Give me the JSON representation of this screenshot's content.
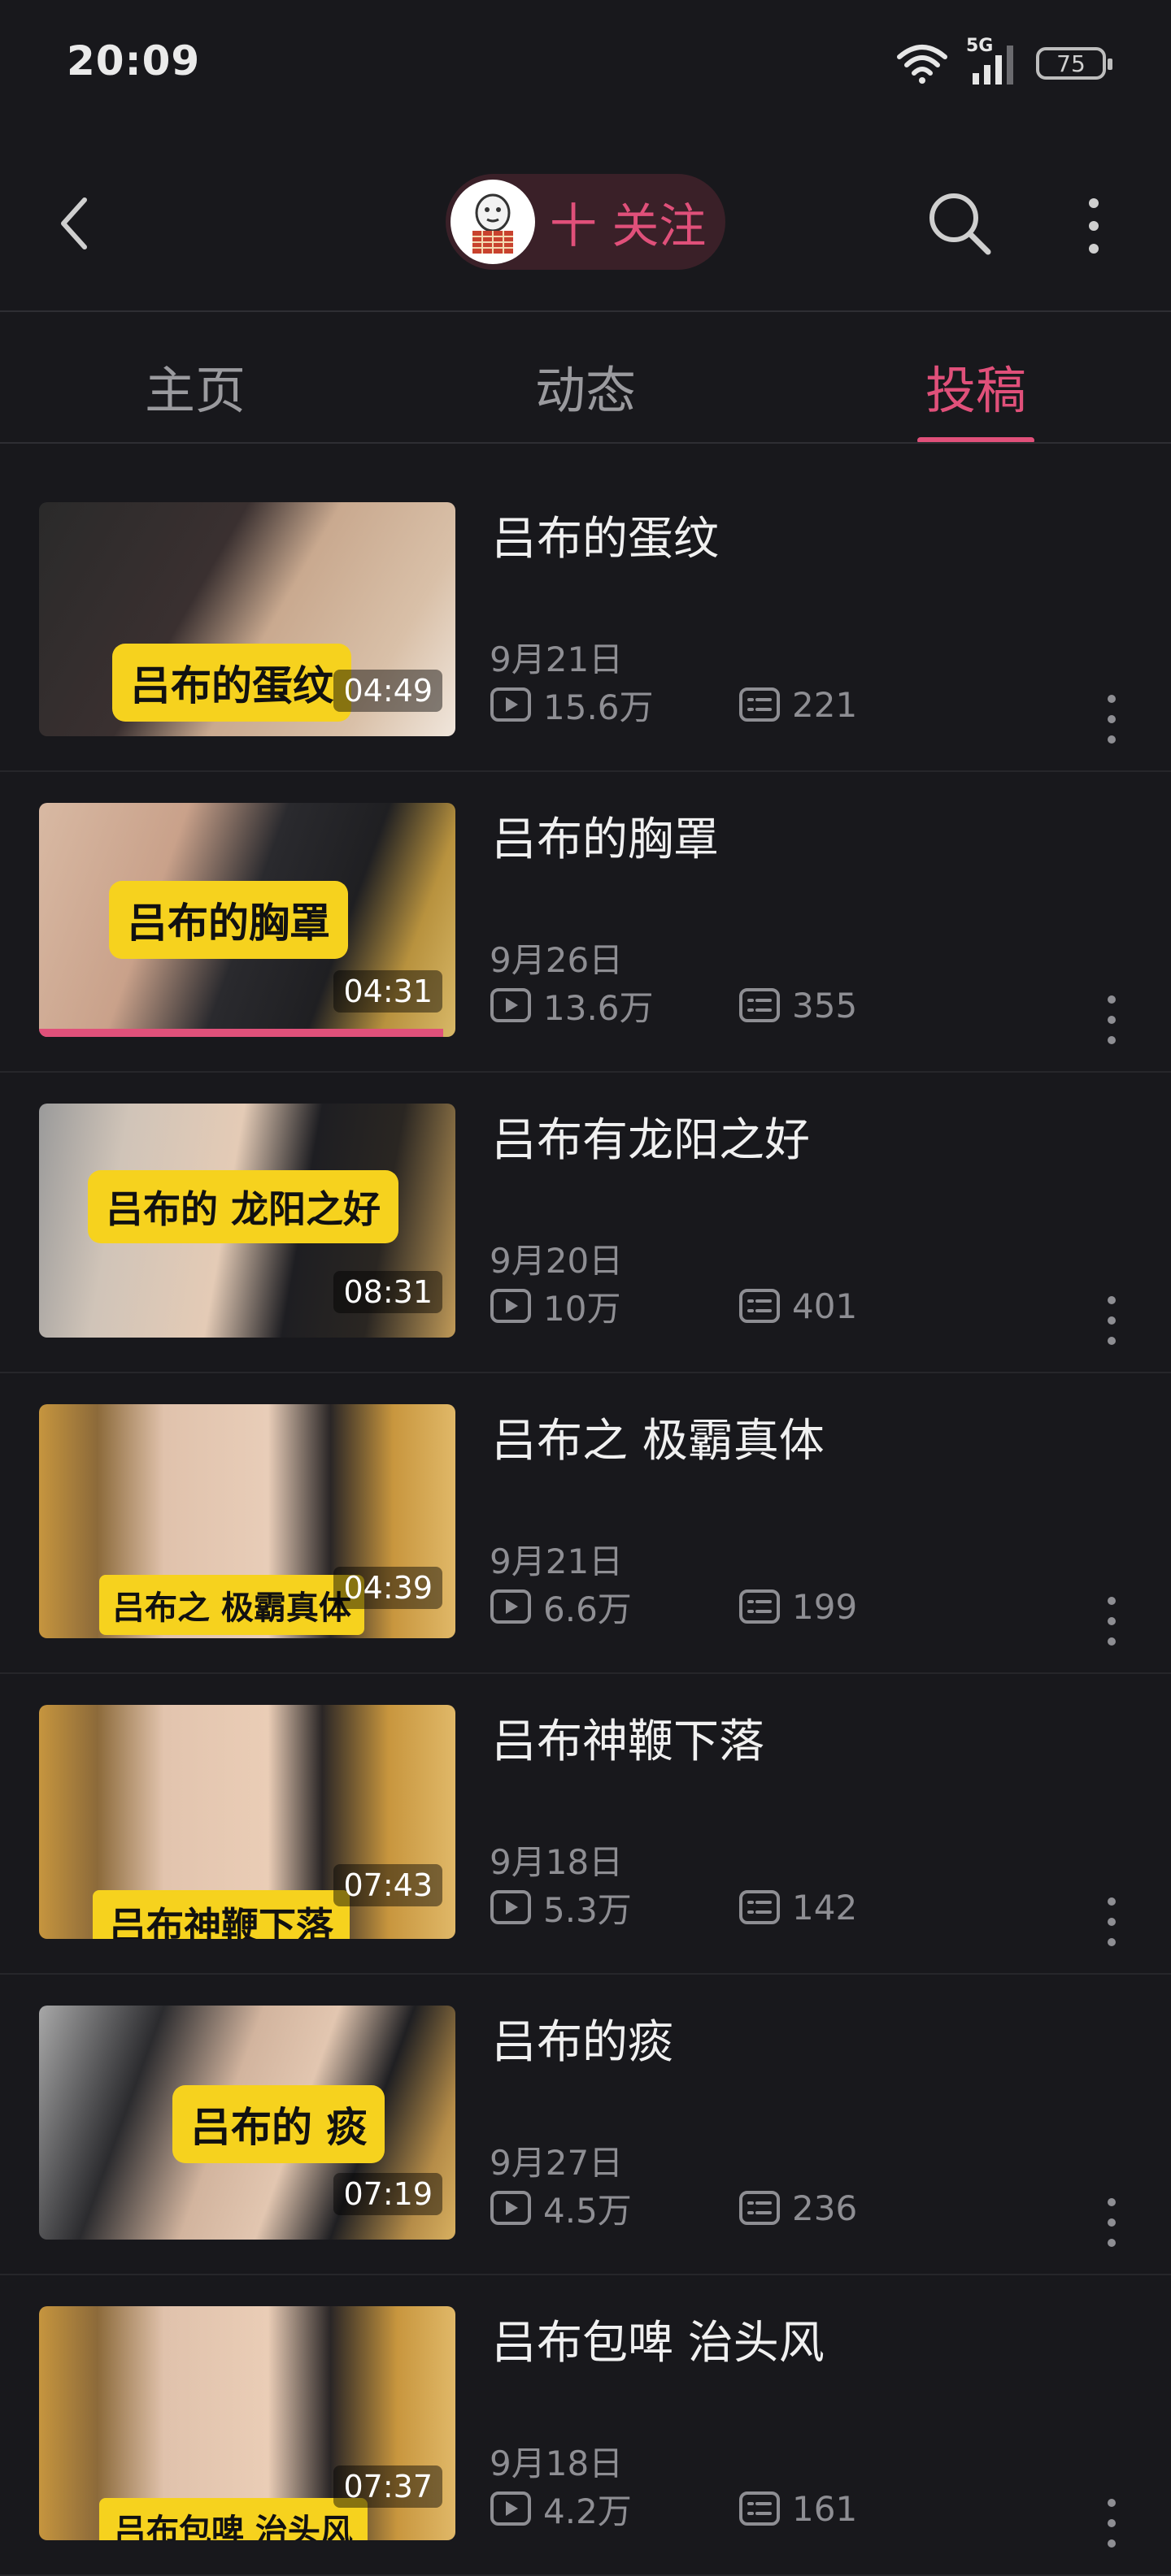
{
  "status_bar": {
    "time": "20:09",
    "network": "5G",
    "battery": "75"
  },
  "header": {
    "follow_label": "十 关注",
    "accent_color": "#e0507a"
  },
  "tabs": [
    {
      "label": "主页",
      "active": false
    },
    {
      "label": "动态",
      "active": false
    },
    {
      "label": "投稿",
      "active": true
    }
  ],
  "videos": [
    {
      "title": "吕布的蛋纹",
      "caption": "吕布的蛋纹",
      "duration": "04:49",
      "date": "9月21日",
      "plays": "15.6万",
      "comments": "221"
    },
    {
      "title": "吕布的胸罩",
      "caption": "吕布的胸罩",
      "duration": "04:31",
      "date": "9月26日",
      "plays": "13.6万",
      "comments": "355",
      "watch_progress": 0.97
    },
    {
      "title": "吕布有龙阳之好",
      "caption": "吕布的 龙阳之好",
      "duration": "08:31",
      "date": "9月20日",
      "plays": "10万",
      "comments": "401"
    },
    {
      "title": "吕布之 极霸真体",
      "caption": "吕布之 极霸真体",
      "duration": "04:39",
      "date": "9月21日",
      "plays": "6.6万",
      "comments": "199"
    },
    {
      "title": "吕布神鞭下落",
      "caption": "吕布神鞭下落",
      "duration": "07:43",
      "date": "9月18日",
      "plays": "5.3万",
      "comments": "142"
    },
    {
      "title": "吕布的痰",
      "caption": "吕布的 痰",
      "duration": "07:19",
      "date": "9月27日",
      "plays": "4.5万",
      "comments": "236"
    },
    {
      "title": "吕布包啤 治头风",
      "caption": "吕布包啤 治头风",
      "duration": "07:37",
      "date": "9月18日",
      "plays": "4.2万",
      "comments": "161"
    }
  ]
}
